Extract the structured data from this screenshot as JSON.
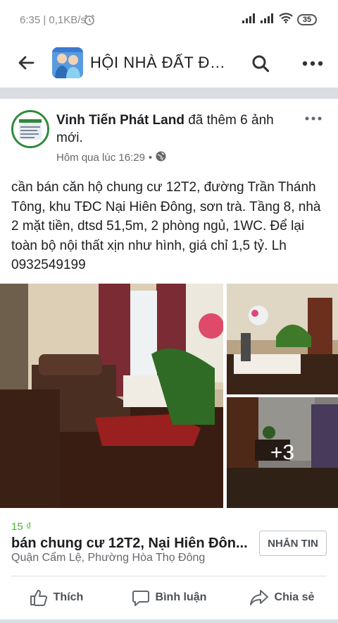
{
  "status": {
    "time_speed": "6:35 | 0,1KB/s",
    "battery": "35"
  },
  "app_bar": {
    "group_title": "HỘI NHÀ ĐẤT ĐÀ..."
  },
  "post": {
    "author": "Vinh Tiến Phát Land",
    "action": "đã thêm 6 ảnh mới.",
    "timestamp": "Hôm qua lúc 16:29",
    "text": "cần bán căn hộ chung cư 12T2, đường Trần Thánh Tông, khu TĐC Nại Hiên Đông, sơn trà. Tầng 8, nhà 2 mặt tiền, dtsd 51,5m, 2 phòng ngủ, 1WC. Để lại toàn bộ nội thất xịn như hình, giá chỉ 1,5 tỷ. Lh 0932549199",
    "more_photos": "+3"
  },
  "listing": {
    "price": "15 ₫",
    "title": "bán chung cư 12T2, Nại Hiên Đôn...",
    "location": "Quận Cẩm Lệ, Phường Hòa Thọ Đông",
    "message_button": "NHẮN TIN"
  },
  "actions": {
    "like": "Thích",
    "comment": "Bình luận",
    "share": "Chia sẻ"
  },
  "icons": [
    "alarm-icon",
    "signal-icon",
    "wifi-icon",
    "battery-icon",
    "back-arrow-icon",
    "search-icon",
    "more-icon",
    "globe-icon",
    "like-icon",
    "comment-icon",
    "share-icon"
  ]
}
